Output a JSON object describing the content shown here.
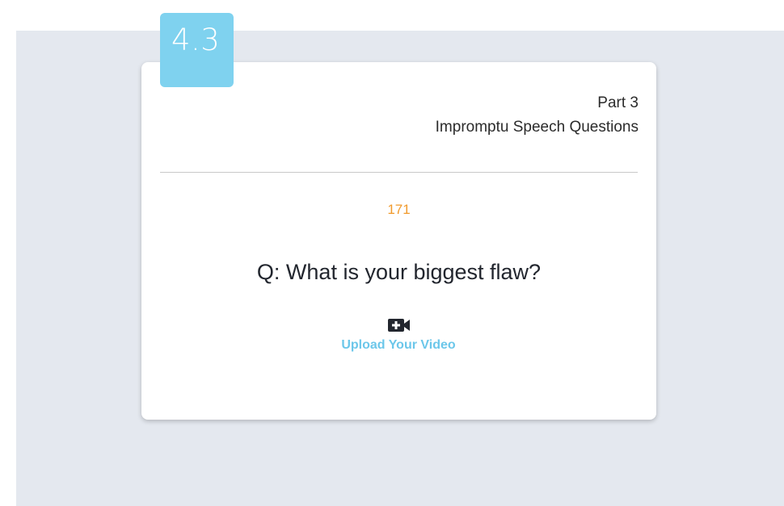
{
  "badge": {
    "label": "4.3"
  },
  "header": {
    "part": "Part 3",
    "title": "Impromptu Speech Questions"
  },
  "question": {
    "number": "171",
    "text": "Q: What is your biggest flaw?"
  },
  "upload": {
    "icon": "video-camera-plus-icon",
    "label": "Upload Your Video"
  },
  "colors": {
    "background": "#e4e8ef",
    "badge": "#7fd2ef",
    "number": "#f19a2c",
    "upload_label": "#6cc7ea",
    "question_text": "#22262e"
  }
}
